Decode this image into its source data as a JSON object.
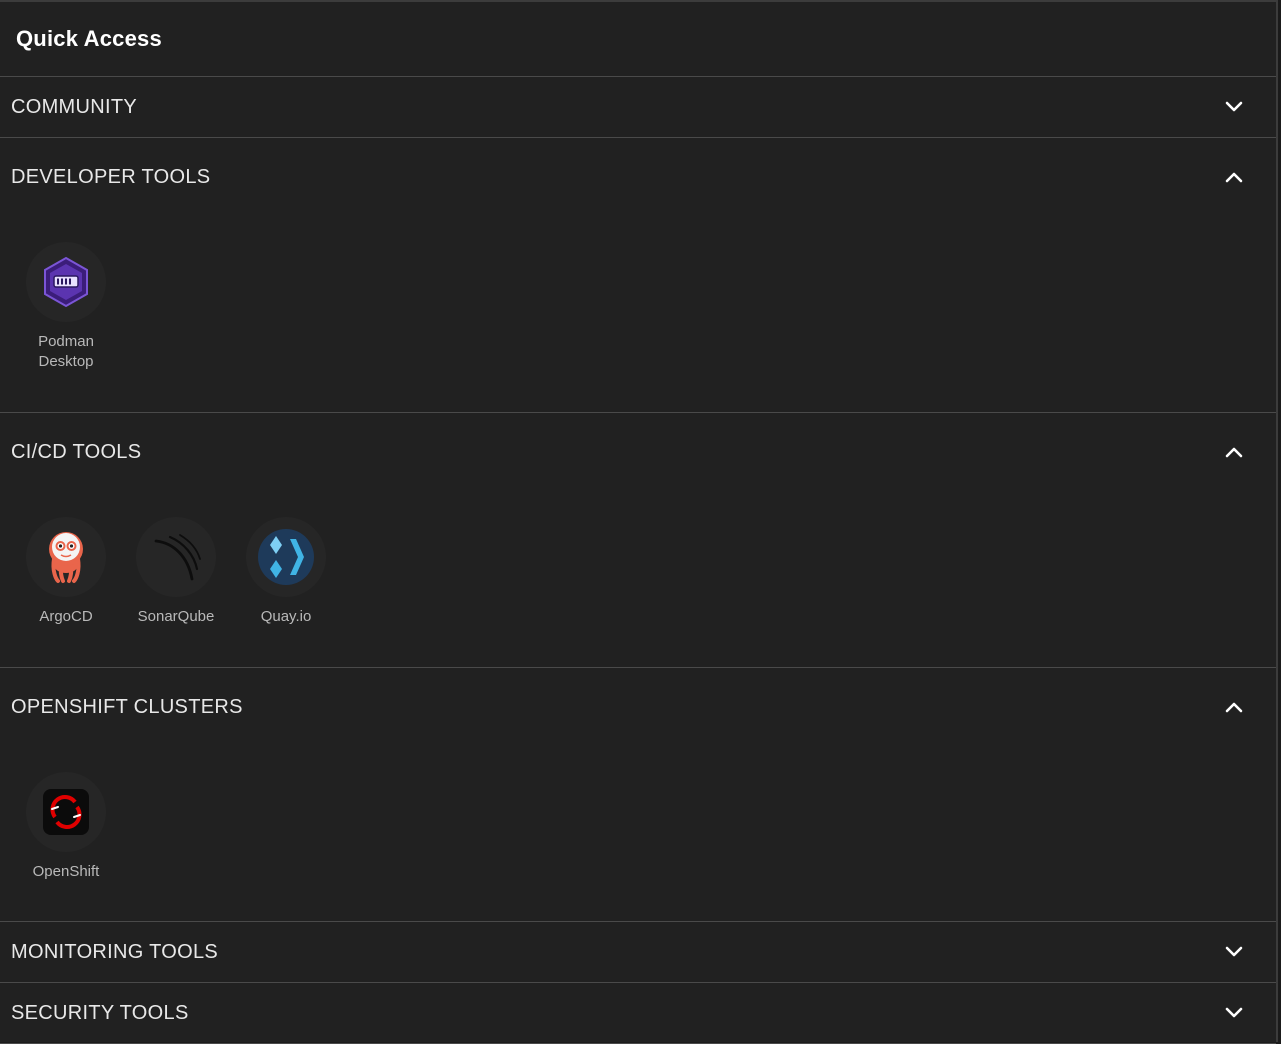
{
  "header": {
    "title": "Quick Access"
  },
  "sections": [
    {
      "label": "COMMUNITY",
      "expanded": false
    },
    {
      "label": "DEVELOPER TOOLS",
      "expanded": true,
      "items": [
        {
          "label": "Podman Desktop",
          "icon": "podman-icon"
        }
      ]
    },
    {
      "label": "CI/CD TOOLS",
      "expanded": true,
      "items": [
        {
          "label": "ArgoCD",
          "icon": "argocd-icon"
        },
        {
          "label": "SonarQube",
          "icon": "sonarqube-icon"
        },
        {
          "label": "Quay.io",
          "icon": "quay-icon"
        }
      ]
    },
    {
      "label": "OPENSHIFT CLUSTERS",
      "expanded": true,
      "items": [
        {
          "label": "OpenShift",
          "icon": "openshift-icon"
        }
      ]
    },
    {
      "label": "MONITORING TOOLS",
      "expanded": false
    },
    {
      "label": "SECURITY TOOLS",
      "expanded": false
    }
  ],
  "colors": {
    "background": "#212121",
    "divider": "#4a4a4a",
    "podman": "#6a3fb5",
    "argocd": "#e9654b",
    "quay": "#40b4e5",
    "openshift": "#e00000"
  }
}
